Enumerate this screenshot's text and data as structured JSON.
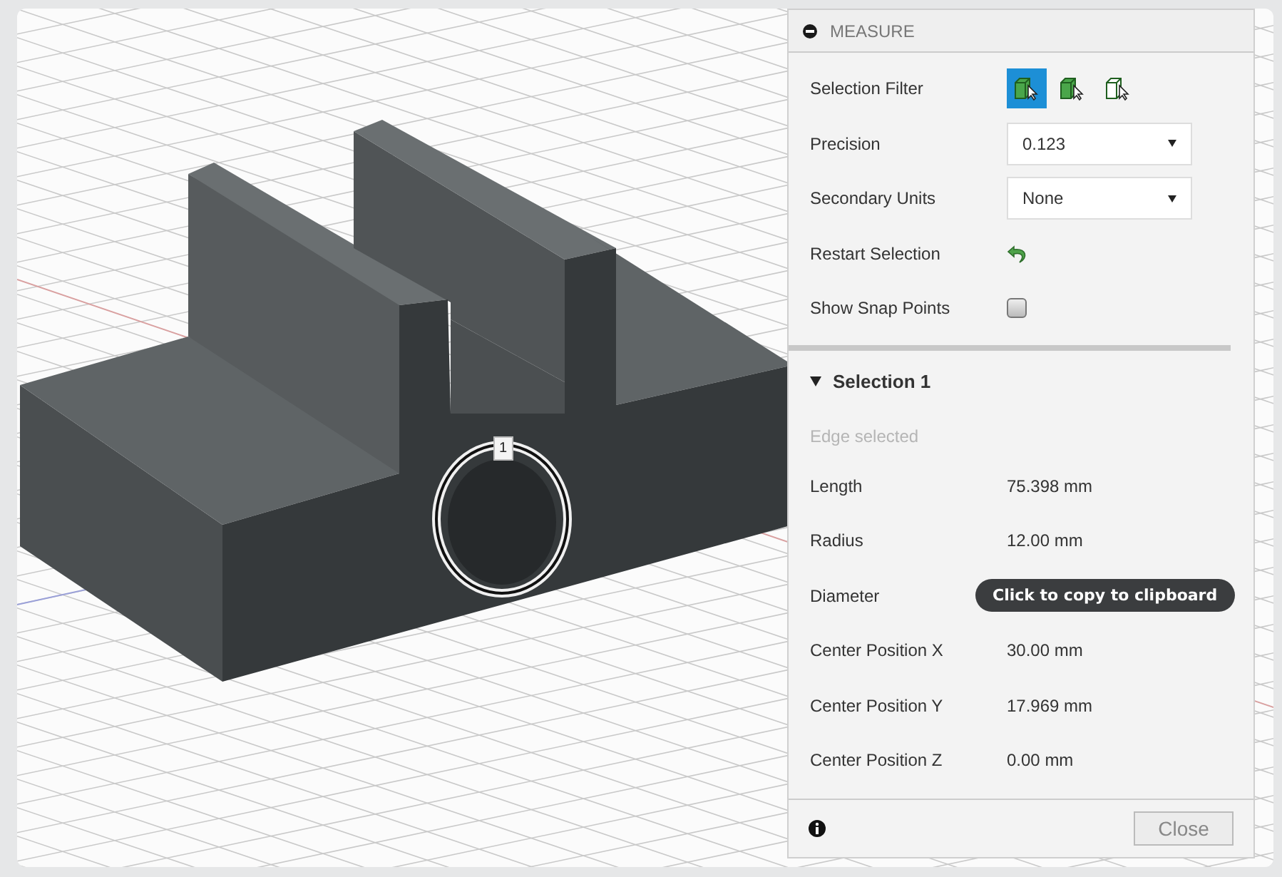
{
  "viewport": {
    "marker": "1"
  },
  "panel": {
    "title": "MEASURE",
    "settings": [
      {
        "kind": "filter",
        "label": "Selection Filter",
        "filters": [
          {
            "selected": true
          },
          {
            "selected": false
          },
          {
            "selected": false
          }
        ]
      },
      {
        "kind": "dropdown",
        "label": "Precision",
        "value": "0.123"
      },
      {
        "kind": "dropdown",
        "label": "Secondary Units",
        "value": "None"
      },
      {
        "kind": "restart",
        "label": "Restart Selection"
      },
      {
        "kind": "checkbox",
        "label": "Show Snap Points",
        "checked": false
      }
    ],
    "selection": {
      "title": "Selection 1",
      "expanded": true,
      "status": "Edge selected",
      "rows": [
        {
          "label": "Length",
          "value": "75.398 mm"
        },
        {
          "label": "Radius",
          "value": "12.00 mm"
        },
        {
          "label": "Diameter",
          "tooltip": "Click to copy to clipboard"
        },
        {
          "label": "Center Position X",
          "value": "30.00 mm"
        },
        {
          "label": "Center Position Y",
          "value": "17.969 mm"
        },
        {
          "label": "Center Position Z",
          "value": "0.00 mm"
        }
      ]
    },
    "close_button": "Close"
  }
}
